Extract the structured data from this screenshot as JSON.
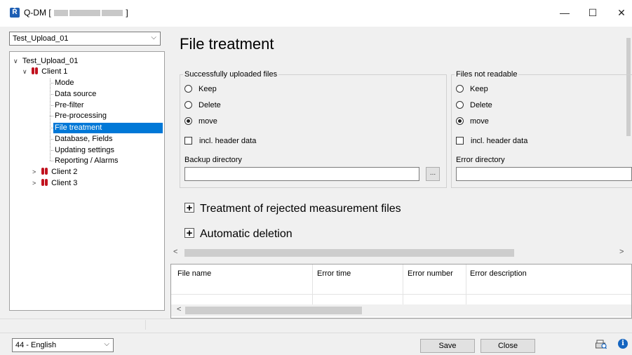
{
  "window": {
    "title": "Q-DM [",
    "title_suffix": "]",
    "minimize_glyph": "—",
    "maximize_glyph": "☐",
    "close_glyph": "✕"
  },
  "left": {
    "select_value": "Test_Upload_01",
    "tree": {
      "root": "Test_Upload_01",
      "client1": "Client 1",
      "items": [
        "Mode",
        "Data source",
        "Pre-filter",
        "Pre-processing",
        "File treatment",
        "Database, Fields",
        "Updating settings",
        "Reporting / Alarms"
      ],
      "selected_index": 4,
      "client2": "Client 2",
      "client3": "Client 3"
    }
  },
  "main": {
    "title": "File treatment",
    "success_group": {
      "legend": "Successfully uploaded files",
      "options": [
        "Keep",
        "Delete",
        "move"
      ],
      "selected": "move",
      "header_checkbox": "incl. header data",
      "dir_label": "Backup directory",
      "dir_value": "",
      "browse_label": "..."
    },
    "notreadable_group": {
      "legend": "Files not readable",
      "options": [
        "Keep",
        "Delete",
        "move"
      ],
      "selected": "move",
      "header_checkbox": "incl. header data",
      "dir_label": "Error directory",
      "dir_value": ""
    },
    "expand_rejected": "Treatment of rejected measurement files",
    "expand_deletion": "Automatic deletion",
    "plus_glyph": "+"
  },
  "grid": {
    "columns": [
      "File name",
      "Error time",
      "Error number",
      "Error description"
    ]
  },
  "bottom": {
    "language": "44 - English",
    "save": "Save",
    "close": "Close",
    "info_glyph": "i"
  },
  "icons": {
    "app": "q-dm-app-icon",
    "print": "print-preview-icon",
    "info": "info-icon"
  },
  "colors": {
    "selection": "#0078d7",
    "client_icon": "#c1121f",
    "info": "#1565c0"
  }
}
